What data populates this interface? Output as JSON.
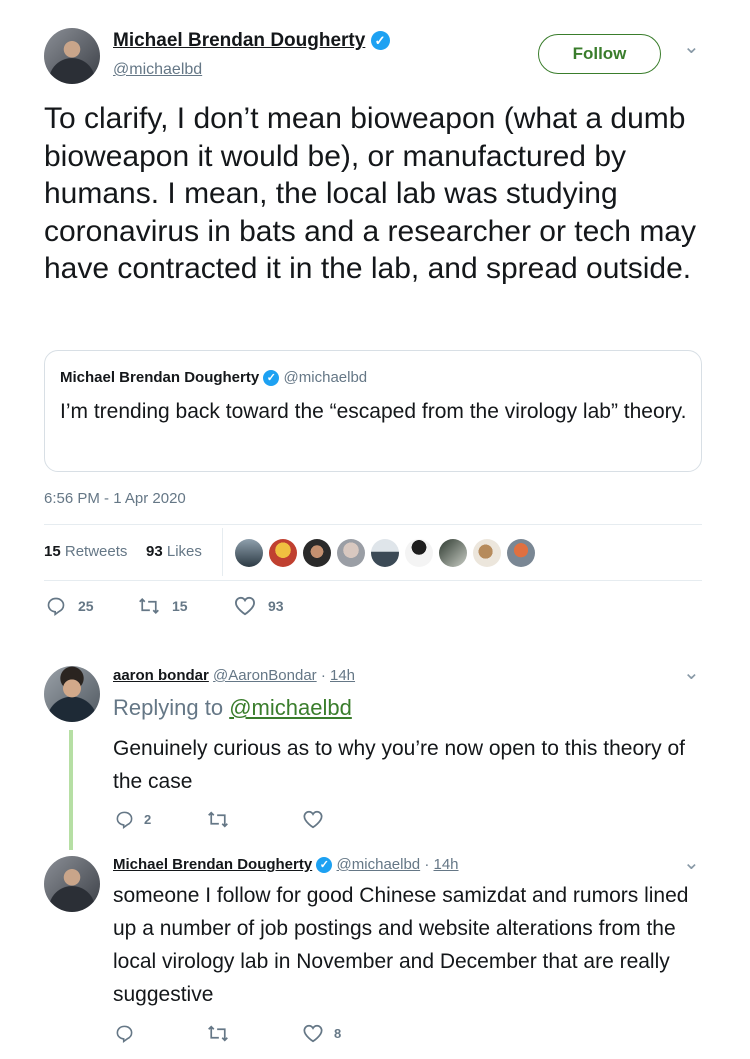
{
  "tweet": {
    "author_name": "Michael Brendan Dougherty",
    "author_handle": "@michaelbd",
    "follow_label": "Follow",
    "text": "To clarify, I don’t mean bioweapon (what a dumb bioweapon it would be), or manufactured by humans. I mean, the local lab was studying coronavirus in bats and a researcher or tech may have contracted it in the lab, and spread outside.",
    "quote": {
      "author_name": "Michael Brendan Dougherty",
      "author_handle": "@michaelbd",
      "text": "I’m trending back toward the “escaped from the virology lab” theory."
    },
    "timestamp": "6:56 PM - 1 Apr 2020",
    "retweets_count": "15",
    "retweets_label": "Retweets",
    "likes_count": "93",
    "likes_label": "Likes",
    "actions": {
      "reply": "25",
      "retweet": "15",
      "like": "93"
    }
  },
  "replies": [
    {
      "author_name": "aaron bondar",
      "author_handle": "@AaronBondar",
      "sep": "·",
      "time": "14h",
      "replying_prefix": "Replying to",
      "replying_to": "@michaelbd",
      "text": "Genuinely curious as to why you’re now open to this theory of the case",
      "actions": {
        "reply": "2",
        "retweet": "",
        "like": ""
      }
    },
    {
      "author_name": "Michael Brendan Dougherty",
      "author_handle": "@michaelbd",
      "sep": "·",
      "time": "14h",
      "text": "someone I follow for good Chinese samizdat and rumors lined up a number of job postings and website alterations from the local virology lab in November and December that are really suggestive",
      "actions": {
        "reply": "",
        "retweet": "",
        "like": "8"
      }
    }
  ],
  "icons": {
    "verified": "✓",
    "chevron": "⌄"
  },
  "colors": {
    "accent_green": "#3a7d2c",
    "verified_blue": "#1da1f2",
    "muted": "#657786"
  }
}
